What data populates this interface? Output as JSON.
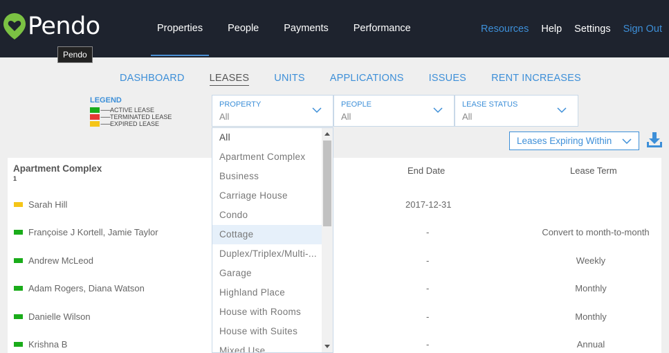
{
  "brand": {
    "name": "Pendo",
    "tooltip": "Pendo"
  },
  "colors": {
    "topbar": "#1e232e",
    "accent": "#3d8fd8",
    "active_lease": "#1aac1a",
    "terminated_lease": "#e53935",
    "expired_lease": "#f5c518"
  },
  "main_nav": [
    {
      "label": "Properties",
      "active": true
    },
    {
      "label": "People"
    },
    {
      "label": "Payments"
    },
    {
      "label": "Performance"
    }
  ],
  "right_nav": {
    "resources": "Resources",
    "help": "Help",
    "settings": "Settings",
    "sign_out": "Sign Out"
  },
  "sub_nav": [
    {
      "label": "DASHBOARD"
    },
    {
      "label": "LEASES",
      "active": true
    },
    {
      "label": "UNITS"
    },
    {
      "label": "APPLICATIONS"
    },
    {
      "label": "ISSUES"
    },
    {
      "label": "RENT INCREASES"
    }
  ],
  "legend": {
    "title": "LEGEND",
    "items": [
      {
        "dashes": "-------",
        "label": "ACTIVE LEASE",
        "color": "#1aac1a"
      },
      {
        "dashes": "-------",
        "label": "TERMINATED LEASE",
        "color": "#e53935"
      },
      {
        "dashes": "-------",
        "label": "EXPIRED LEASE",
        "color": "#f5c518"
      }
    ]
  },
  "filters": [
    {
      "label": "PROPERTY",
      "value": "All"
    },
    {
      "label": "PEOPLE",
      "value": "All"
    },
    {
      "label": "LEASE STATUS",
      "value": "All"
    }
  ],
  "expiring_button": "Leases Expiring Within",
  "property_dropdown": {
    "options": [
      "All",
      "Apartment Complex",
      "Business",
      "Carriage House",
      "Condo",
      "Cottage",
      "Duplex/Triplex/Multi-...",
      "Garage",
      "Highland Place",
      "House with Rooms",
      "House with Suites",
      "Mixed Use"
    ],
    "hovered": "Cottage"
  },
  "table": {
    "group_title": "Apartment Complex",
    "group_count": "1",
    "headers": {
      "end_date": "End Date",
      "lease_term": "Lease Term"
    },
    "rows": [
      {
        "name": "Sarah Hill",
        "end_date": "2017-12-31",
        "lease_term": "",
        "status_color": "#f5c518"
      },
      {
        "name": "Françoise J Kortell, Jamie Taylor",
        "end_date": "-",
        "lease_term": "Convert to month-to-month",
        "status_color": "#1aac1a"
      },
      {
        "name": "Andrew McLeod",
        "end_date": "-",
        "lease_term": "Weekly",
        "status_color": "#1aac1a"
      },
      {
        "name": "Adam Rogers, Diana Watson",
        "end_date": "-",
        "lease_term": "Monthly",
        "status_color": "#1aac1a"
      },
      {
        "name": "Danielle Wilson",
        "end_date": "-",
        "lease_term": "Monthly",
        "status_color": "#1aac1a"
      },
      {
        "name": "Krishna B",
        "end_date": "-",
        "lease_term": "Annual",
        "status_color": "#1aac1a"
      }
    ]
  }
}
